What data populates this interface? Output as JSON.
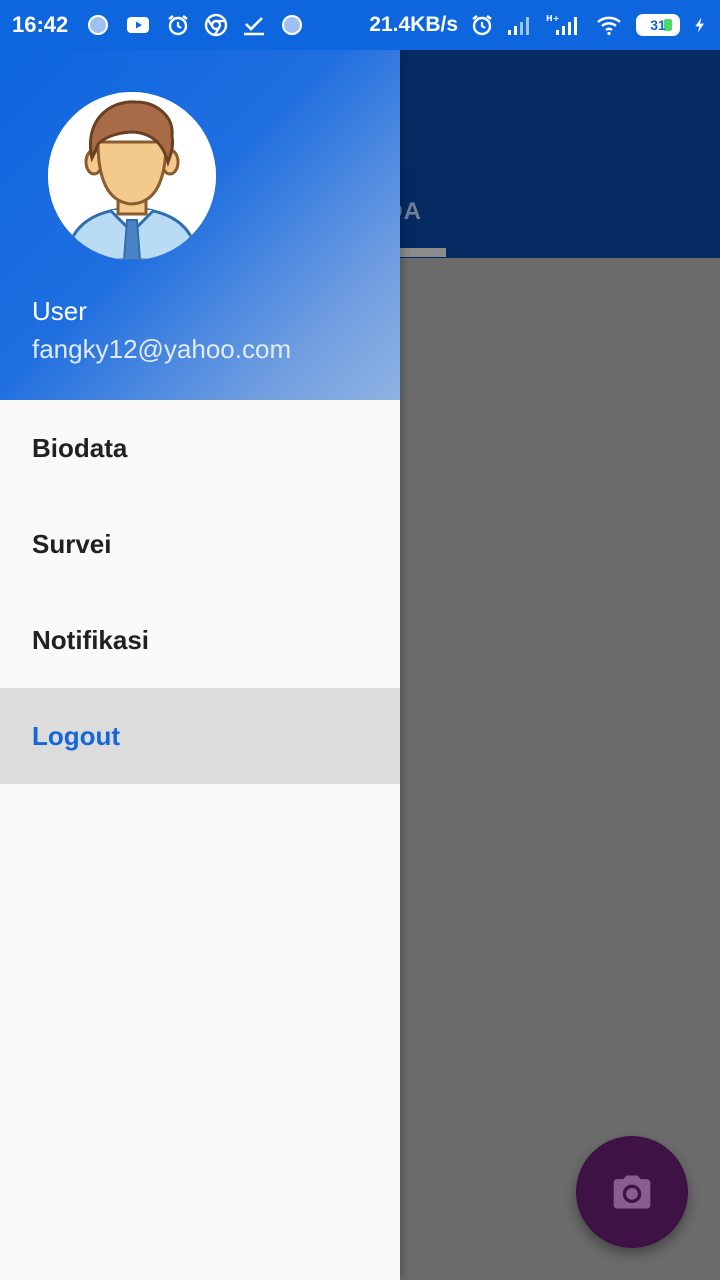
{
  "status_bar": {
    "time": "16:42",
    "net_speed": "21.4KB/s",
    "battery_level": "31",
    "left_icons": [
      "notification-dot-icon",
      "youtube-icon",
      "alarm-icon",
      "chrome-icon",
      "download-done-icon",
      "notification-dot-icon"
    ],
    "right_icons": [
      "alarm-icon",
      "signal-icon",
      "hplus-signal-icon",
      "wifi-icon",
      "battery-icon",
      "charging-icon"
    ]
  },
  "drawer": {
    "header": {
      "user_name": "User",
      "email": "fangky12@yahoo.com"
    },
    "menu": [
      {
        "label": "Biodata",
        "active": false
      },
      {
        "label": "Survei",
        "active": false
      },
      {
        "label": "Notifikasi",
        "active": false
      },
      {
        "label": "Logout",
        "active": true
      }
    ]
  },
  "background": {
    "tab_label_partial": "DA",
    "fab_icon": "camera-icon"
  },
  "colors": {
    "primary": "#0d66de",
    "active_text": "#1766d8",
    "fab": "#3e1245"
  }
}
